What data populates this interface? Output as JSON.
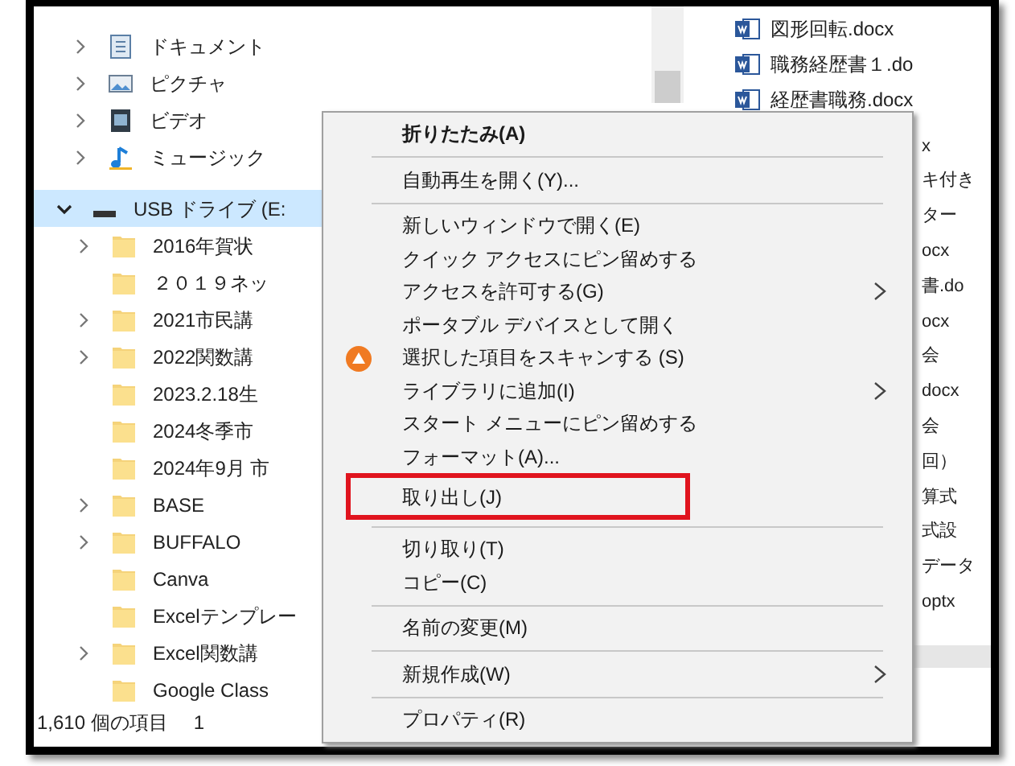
{
  "tree": {
    "items": [
      {
        "label": "ドキュメント",
        "kind": "documents",
        "expandable": true,
        "expanded": false,
        "selected": false
      },
      {
        "label": "ピクチャ",
        "kind": "pictures",
        "expandable": true,
        "expanded": false,
        "selected": false
      },
      {
        "label": "ビデオ",
        "kind": "videos",
        "expandable": true,
        "expanded": false,
        "selected": false
      },
      {
        "label": "ミュージック",
        "kind": "music",
        "expandable": true,
        "expanded": false,
        "selected": false
      },
      {
        "label": "USB ドライブ (E:",
        "kind": "drive",
        "expandable": true,
        "expanded": true,
        "selected": true,
        "children": [
          {
            "label": "2016年賀状",
            "kind": "folder",
            "expandable": true,
            "expanded": false,
            "selected": false
          },
          {
            "label": "２０１９ネッ",
            "kind": "folder",
            "expandable": false,
            "selected": false
          },
          {
            "label": "2021市民講",
            "kind": "folder",
            "expandable": true,
            "expanded": false,
            "selected": false
          },
          {
            "label": "2022関数講",
            "kind": "folder",
            "expandable": true,
            "expanded": false,
            "selected": false
          },
          {
            "label": "2023.2.18生",
            "kind": "folder",
            "expandable": false,
            "selected": false
          },
          {
            "label": "2024冬季市",
            "kind": "folder",
            "expandable": false,
            "selected": false
          },
          {
            "label": "2024年9月 市",
            "kind": "folder",
            "expandable": false,
            "selected": false
          },
          {
            "label": "BASE",
            "kind": "folder",
            "expandable": true,
            "expanded": false,
            "selected": false
          },
          {
            "label": "BUFFALO",
            "kind": "folder",
            "expandable": true,
            "expanded": false,
            "selected": false
          },
          {
            "label": "Canva",
            "kind": "folder",
            "expandable": false,
            "selected": false
          },
          {
            "label": "Excelテンプレー",
            "kind": "folder",
            "expandable": false,
            "selected": false
          },
          {
            "label": "Excel関数講",
            "kind": "folder",
            "expandable": true,
            "expanded": false,
            "selected": false
          },
          {
            "label": "Google Class",
            "kind": "folder",
            "expandable": false,
            "selected": false
          }
        ]
      }
    ]
  },
  "files": [
    {
      "name": "図形回転.docx"
    },
    {
      "name": "職務経歴書１.do"
    },
    {
      "name": "経歴書職務.docx"
    }
  ],
  "file_fragments": [
    "x",
    "キ付き",
    "ター",
    "ocx",
    "書.do",
    "ocx",
    "会",
    "docx",
    "会",
    "回）",
    "算式",
    "式設",
    "データ",
    "optx"
  ],
  "status_bar": {
    "count": "1,610 個の項目",
    "selection": "1"
  },
  "context_menu": {
    "items": [
      {
        "kind": "item",
        "label": "折りたたみ(A)",
        "bold": true,
        "submenu": false,
        "highlighted": false
      },
      {
        "kind": "separator"
      },
      {
        "kind": "item",
        "label": "自動再生を開く(Y)...",
        "bold": false,
        "submenu": false,
        "highlighted": false
      },
      {
        "kind": "separator"
      },
      {
        "kind": "item",
        "label": "新しいウィンドウで開く(E)",
        "bold": false,
        "submenu": false,
        "highlighted": false
      },
      {
        "kind": "item",
        "label": "クイック アクセスにピン留めする",
        "bold": false,
        "submenu": false,
        "highlighted": false
      },
      {
        "kind": "item",
        "label": "アクセスを許可する(G)",
        "bold": false,
        "submenu": true,
        "highlighted": false
      },
      {
        "kind": "item",
        "label": "ポータブル デバイスとして開く",
        "bold": false,
        "submenu": false,
        "highlighted": false
      },
      {
        "kind": "icon_item",
        "label": "選択した項目をスキャンする (S)",
        "bold": false,
        "submenu": false,
        "highlighted": false
      },
      {
        "kind": "item",
        "label": "ライブラリに追加(I)",
        "bold": false,
        "submenu": true,
        "highlighted": false
      },
      {
        "kind": "item",
        "label": "スタート メニューにピン留めする",
        "bold": false,
        "submenu": false,
        "highlighted": false
      },
      {
        "kind": "item",
        "label": "フォーマット(A)...",
        "bold": false,
        "submenu": false,
        "highlighted": false
      },
      {
        "kind": "item",
        "label": "取り出し(J)",
        "bold": false,
        "submenu": false,
        "highlighted": true
      },
      {
        "kind": "separator"
      },
      {
        "kind": "item",
        "label": "切り取り(T)",
        "bold": false,
        "submenu": false,
        "highlighted": false
      },
      {
        "kind": "item",
        "label": "コピー(C)",
        "bold": false,
        "submenu": false,
        "highlighted": false
      },
      {
        "kind": "separator"
      },
      {
        "kind": "item",
        "label": "名前の変更(M)",
        "bold": false,
        "submenu": false,
        "highlighted": false
      },
      {
        "kind": "separator"
      },
      {
        "kind": "item",
        "label": "新規作成(W)",
        "bold": false,
        "submenu": true,
        "highlighted": false
      },
      {
        "kind": "separator"
      },
      {
        "kind": "item",
        "label": "プロパティ(R)",
        "bold": false,
        "submenu": false,
        "highlighted": false
      }
    ]
  }
}
